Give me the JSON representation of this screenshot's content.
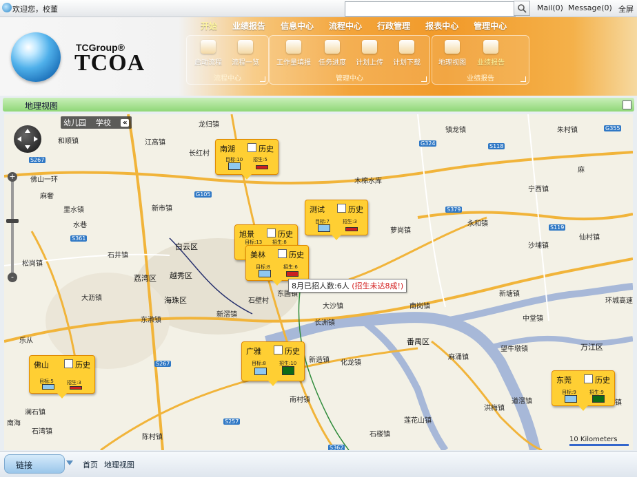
{
  "topbar": {
    "welcome": "欢迎您，校董",
    "search_placeholder": "",
    "mail": "Mail(0)",
    "message": "Message(0)",
    "fullscreen": "全屏"
  },
  "brand": {
    "small": "TCGroup®",
    "big": "TCOA"
  },
  "nav": [
    "开始",
    "业绩报告",
    "信息中心",
    "流程中心",
    "行政管理",
    "报表中心",
    "管理中心"
  ],
  "groups": [
    {
      "title": "流程中心",
      "items": [
        "启动流程",
        "流程一览"
      ]
    },
    {
      "title": "管理中心",
      "items": [
        "工作量填报",
        "任务进度",
        "计划上传",
        "计划下载"
      ]
    },
    {
      "title": "业绩报告",
      "items": [
        "地理视图",
        "业绩报告"
      ]
    }
  ],
  "page_title": "地理视图",
  "map": {
    "tabs": [
      "幼儿园",
      "学校",
      "«"
    ],
    "zoom": {
      "plus": "+",
      "minus": "-"
    },
    "scale": "10 Kilometers",
    "tooltip": {
      "text": "8月已招人数:6人",
      "warning": "(招生未达8成!)"
    },
    "labels": [
      {
        "t": "龙归镇"
      },
      {
        "t": "和顺镇"
      },
      {
        "t": "江高镇"
      },
      {
        "t": "长红村"
      },
      {
        "t": "佛山一环"
      },
      {
        "t": "麻奢"
      },
      {
        "t": "里水镇"
      },
      {
        "t": "水巷"
      },
      {
        "t": "新市镇"
      },
      {
        "t": "白云区"
      },
      {
        "t": "石井镇"
      },
      {
        "t": "越秀区"
      },
      {
        "t": "荔湾区"
      },
      {
        "t": "松岗镇"
      },
      {
        "t": "大沥镇"
      },
      {
        "t": "海珠区"
      },
      {
        "t": "东漖镇"
      },
      {
        "t": "新滘镇"
      },
      {
        "t": "石壁村"
      },
      {
        "t": "东圃镇"
      },
      {
        "t": "大沙镇"
      },
      {
        "t": "长洲镇"
      },
      {
        "t": "新造镇"
      },
      {
        "t": "化龙镇"
      },
      {
        "t": "南村镇"
      },
      {
        "t": "陈村镇"
      },
      {
        "t": "莲花山镇"
      },
      {
        "t": "石楼镇"
      },
      {
        "t": "番禺区"
      },
      {
        "t": "麻涌镇"
      },
      {
        "t": "万江区"
      },
      {
        "t": "中堂镇"
      },
      {
        "t": "望牛墩镇"
      },
      {
        "t": "洪梅镇"
      },
      {
        "t": "道滘镇"
      },
      {
        "t": "镇龙镇"
      },
      {
        "t": "朱村镇"
      },
      {
        "t": "宁西镇"
      },
      {
        "t": "永和镇"
      },
      {
        "t": "萝岗镇"
      },
      {
        "t": "沙埔镇"
      },
      {
        "t": "南岗镇"
      },
      {
        "t": "新塘镇"
      },
      {
        "t": "仙村镇"
      },
      {
        "t": "麻"
      },
      {
        "t": "新塘镇"
      },
      {
        "t": "高埗镇"
      },
      {
        "t": "石湾镇"
      },
      {
        "t": "南海"
      },
      {
        "t": "澜石镇"
      },
      {
        "t": "乐从"
      },
      {
        "t": "木棉水库"
      },
      {
        "t": "广东省路"
      },
      {
        "t": "中新镇"
      },
      {
        "t": "环城高速"
      }
    ],
    "pins": [
      {
        "name": "南湖",
        "history": "历史",
        "target_label": "目标:10",
        "enrolled_label": "招生:5",
        "status": "red"
      },
      {
        "name": "测试",
        "history": "历史",
        "target_label": "目标:7",
        "enrolled_label": "招生:3",
        "status": "red"
      },
      {
        "name": "旭景",
        "history": "历史",
        "target_label": "目标:13",
        "enrolled_label": "招生:8",
        "status": "red"
      },
      {
        "name": "美林",
        "history": "历史",
        "target_label": "目标:8",
        "enrolled_label": "招生:6",
        "status": "red"
      },
      {
        "name": "佛山",
        "history": "历史",
        "target_label": "目标:5",
        "enrolled_label": "招生:3",
        "status": "red"
      },
      {
        "name": "广雅",
        "history": "历史",
        "target_label": "目标:8",
        "enrolled_label": "招生:10",
        "status": "green"
      },
      {
        "name": "东莞",
        "history": "历史",
        "target_label": "目标:9",
        "enrolled_label": "招生:9",
        "status": "green"
      }
    ]
  },
  "bottom": {
    "link_button": "链接",
    "breadcrumb_home": "首页",
    "breadcrumb_current": "地理视图"
  },
  "colors": {
    "accent_orange": "#f19a2a",
    "title_green": "#8fd777",
    "pin_yellow": "#ffcf33",
    "bar_blue": "#8fc8f0",
    "bar_red": "#cc2020",
    "bar_green": "#0e6a18"
  }
}
